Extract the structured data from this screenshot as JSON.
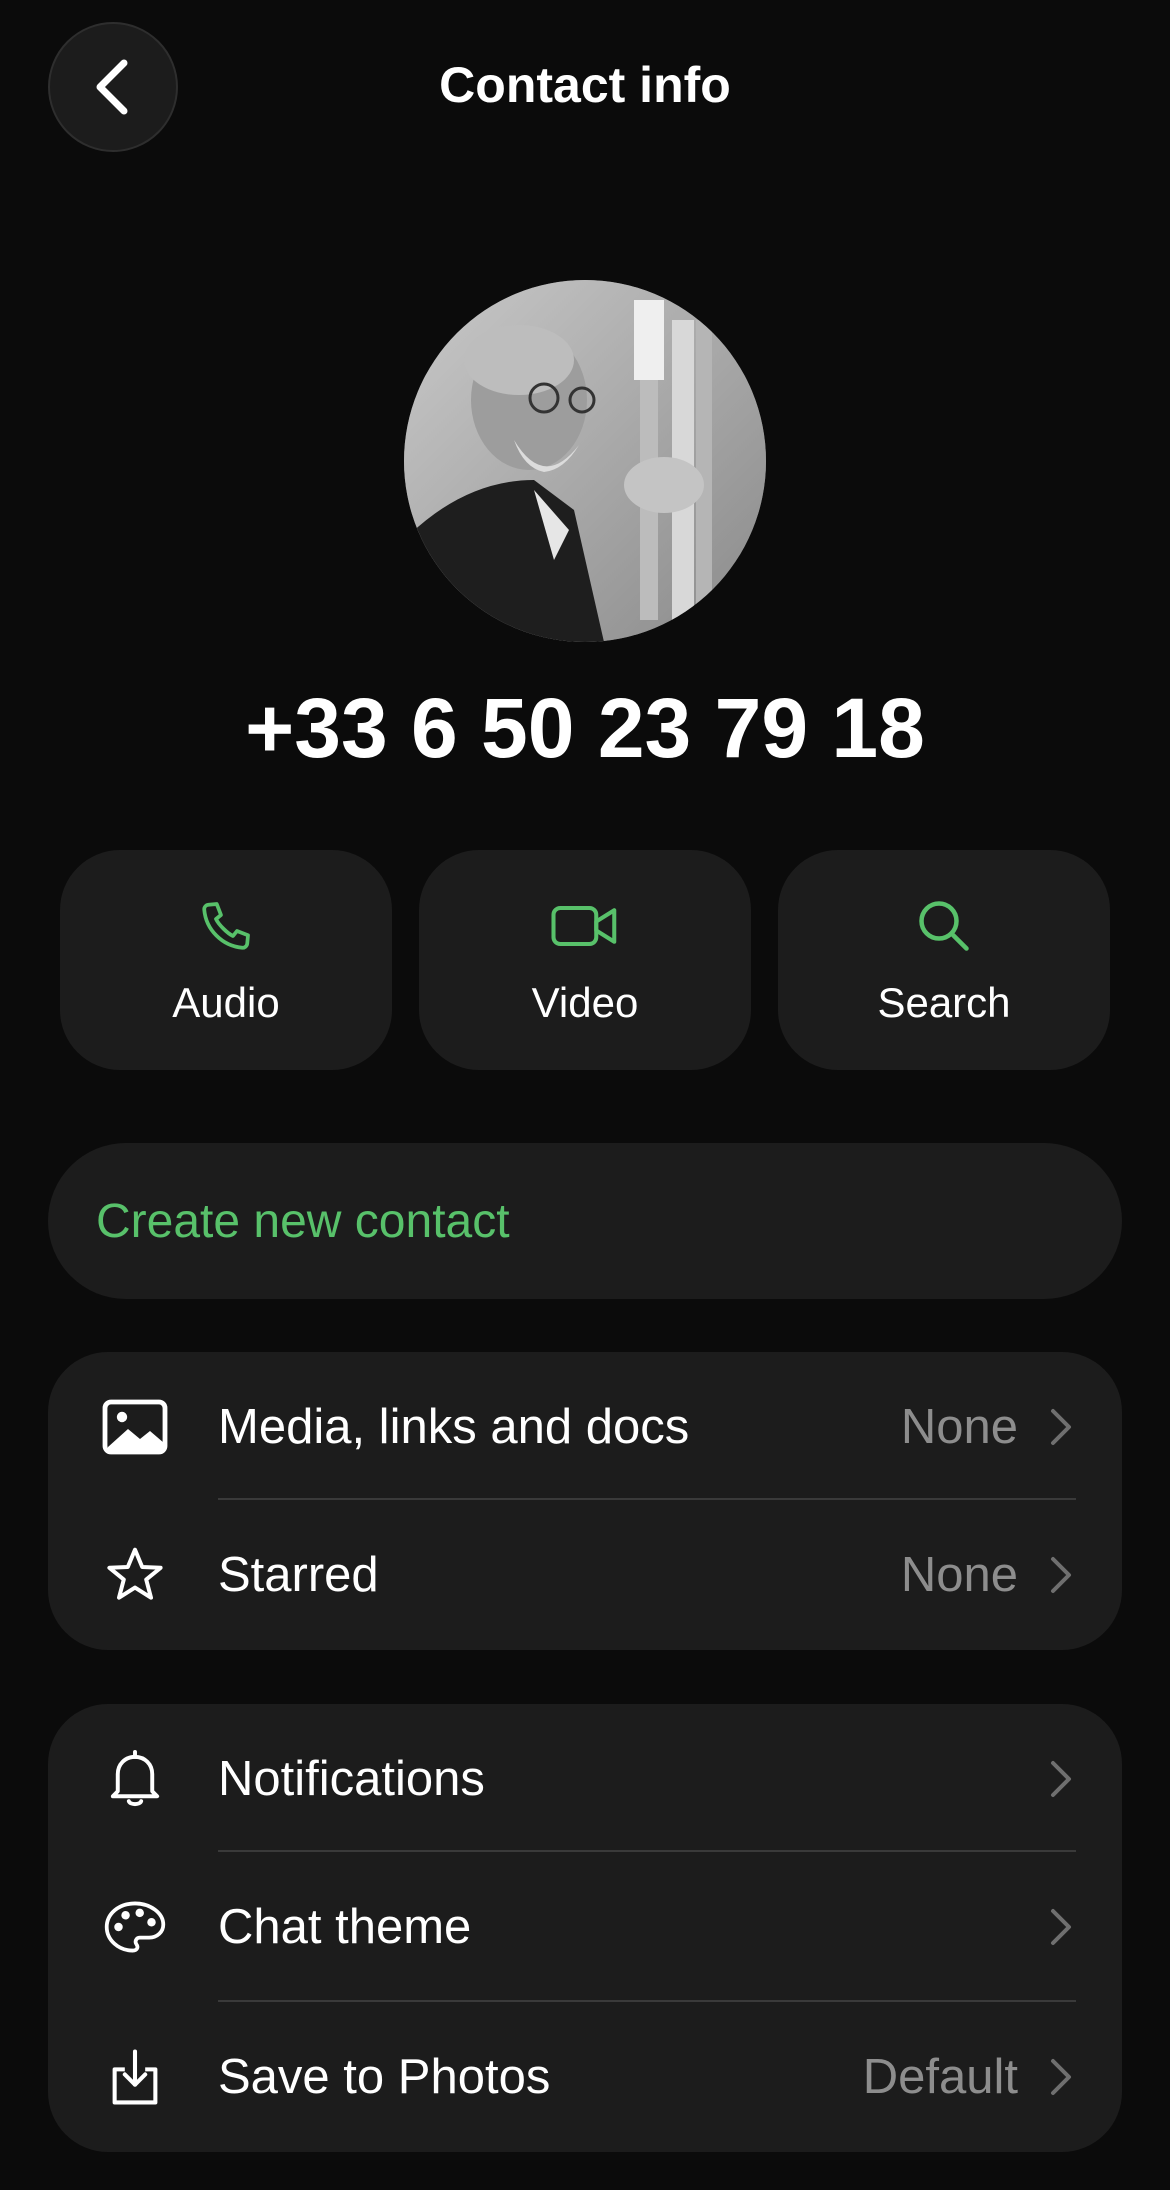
{
  "header": {
    "title": "Contact info"
  },
  "contact": {
    "phone": "+33 6 50 23 79 18"
  },
  "actions": [
    {
      "label": "Audio",
      "icon": "phone-icon"
    },
    {
      "label": "Video",
      "icon": "video-camera-icon"
    },
    {
      "label": "Search",
      "icon": "search-icon"
    }
  ],
  "create_contact": {
    "label": "Create new contact"
  },
  "group1": {
    "items": [
      {
        "label": "Media, links and docs",
        "value": "None",
        "icon": "image-icon"
      },
      {
        "label": "Starred",
        "value": "None",
        "icon": "star-icon"
      }
    ]
  },
  "group2": {
    "items": [
      {
        "label": "Notifications",
        "value": "",
        "icon": "bell-icon"
      },
      {
        "label": "Chat theme",
        "value": "",
        "icon": "palette-icon"
      },
      {
        "label": "Save to Photos",
        "value": "Default",
        "icon": "download-icon"
      }
    ]
  },
  "colors": {
    "accent": "#58c16a",
    "background": "#0b0b0b",
    "card": "#1c1c1c",
    "secondary_text": "#8d8d8d"
  }
}
